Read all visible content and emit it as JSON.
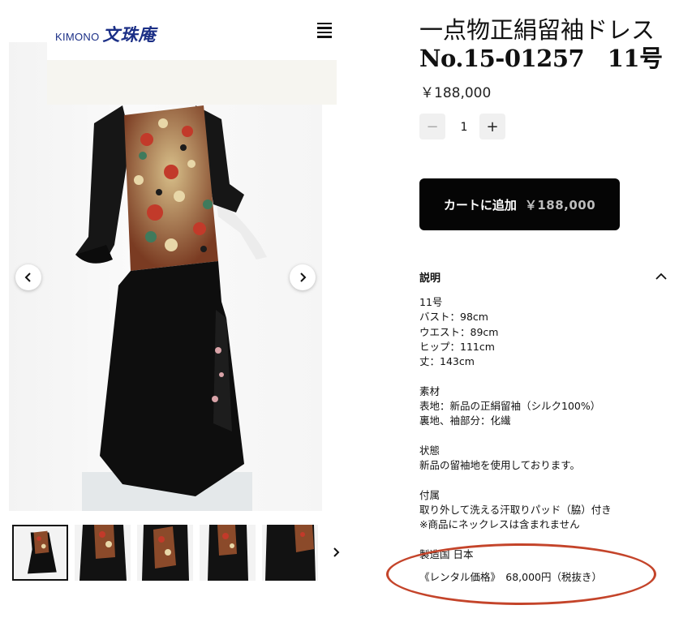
{
  "header": {
    "logo_latin": "KIMONO",
    "logo_kanji": "文珠庵",
    "menu_icon": "hamburger-menu-icon"
  },
  "gallery": {
    "prev_icon": "chevron-left-icon",
    "next_icon": "chevron-right-icon",
    "thumbnail_count": 5,
    "active_thumbnail": 1
  },
  "product": {
    "title_line1": "一点物正絹留袖ドレス",
    "title_line2": "No.15-01257　11号",
    "price": "￥188,000",
    "quantity": "1",
    "add_to_cart_label": "カートに追加",
    "add_to_cart_price": "￥188,000"
  },
  "description": {
    "heading": "説明",
    "size": "11号",
    "bust": "バスト：98cm",
    "waist": "ウエスト：89cm",
    "hip": "ヒップ：111cm",
    "length": "丈：143cm",
    "material_heading": "素材",
    "material_outer": "表地：新品の正絹留袖（シルク100%）",
    "material_inner": "裏地、袖部分：化繊",
    "condition_heading": "状態",
    "condition_text": "新品の留袖地を使用しております。",
    "accessory_heading": "付属",
    "accessory_line1": "取り外して洗える汗取りパッド（脇）付き",
    "accessory_line2": "※商品にネックレスは含まれません",
    "origin": "製造国 日本",
    "rental": "《レンタル価格》　68,000円（税抜き）"
  },
  "colors": {
    "accent_black": "#050505",
    "logo_blue": "#1b2f86",
    "highlight_oval": "#c4442a"
  }
}
